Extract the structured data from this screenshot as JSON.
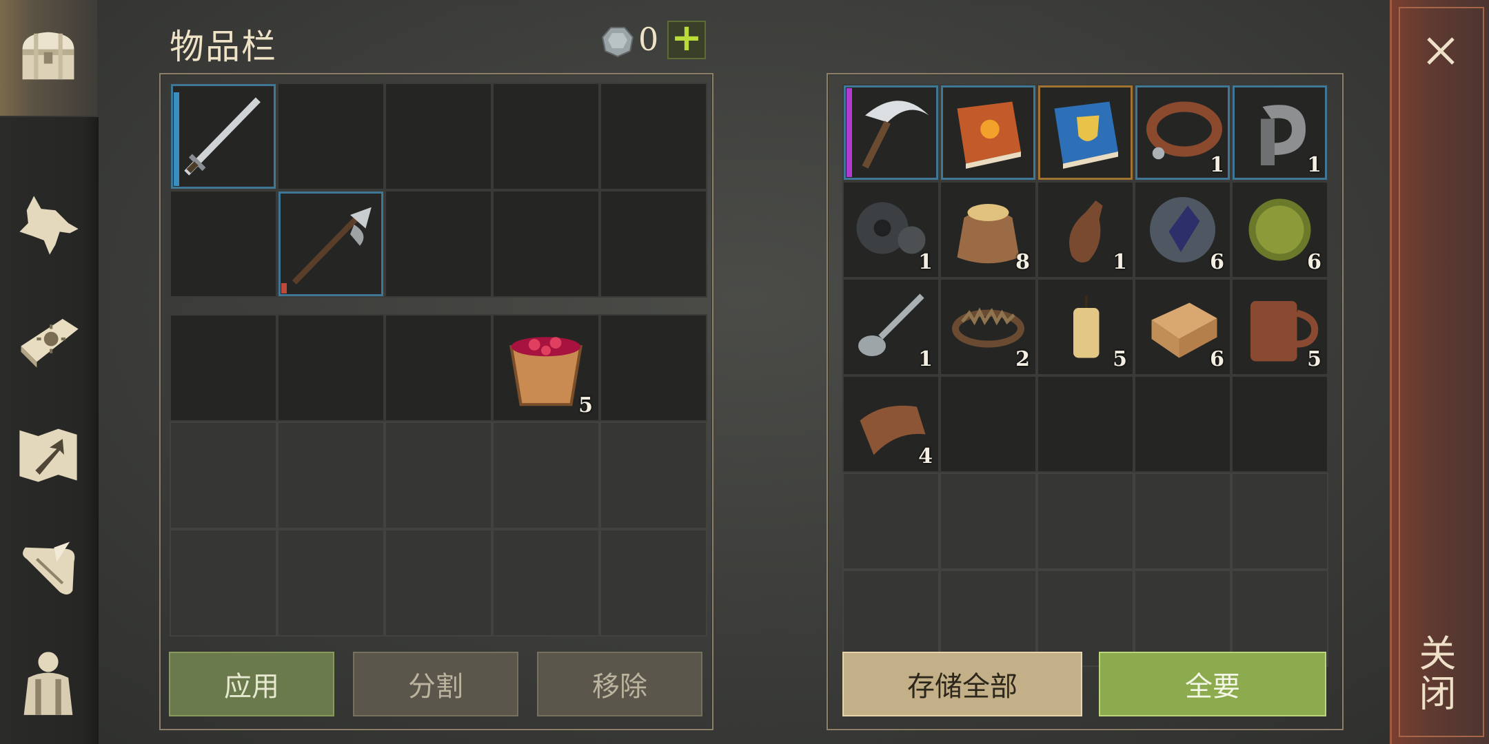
{
  "header": {
    "title": "物品栏",
    "currency_value": "0"
  },
  "player_inventory": {
    "equipment_slots": [
      {
        "item": "sword",
        "frame": "blue",
        "bar_color": "#3a8fc2",
        "bar_fraction": 0.95
      },
      {
        "item": null
      },
      {
        "item": null
      },
      {
        "item": null
      },
      {
        "item": null
      },
      {
        "item": null
      },
      {
        "item": "halberd",
        "frame": "blue",
        "bar_color": "#c04a3a",
        "bar_fraction": 0.15
      },
      {
        "item": null
      },
      {
        "item": null
      },
      {
        "item": null
      }
    ],
    "backpack_slots": [
      {
        "item": null
      },
      {
        "item": null
      },
      {
        "item": null
      },
      {
        "item": "berry-bucket",
        "count": "5"
      },
      {
        "item": null
      },
      {
        "item": null,
        "locked": true
      },
      {
        "item": null,
        "locked": true
      },
      {
        "item": null,
        "locked": true
      },
      {
        "item": null,
        "locked": true
      },
      {
        "item": null,
        "locked": true
      },
      {
        "item": null,
        "locked": true
      },
      {
        "item": null,
        "locked": true
      },
      {
        "item": null,
        "locked": true
      },
      {
        "item": null,
        "locked": true
      },
      {
        "item": null,
        "locked": true
      }
    ]
  },
  "container": {
    "slots": [
      {
        "item": "sickle",
        "frame": "purple"
      },
      {
        "item": "orange-book",
        "frame": "blue"
      },
      {
        "item": "blue-book",
        "frame": "orange"
      },
      {
        "item": "collar",
        "frame": "blue",
        "count": "1"
      },
      {
        "item": "iron-clamp",
        "frame": "blue",
        "count": "1"
      },
      {
        "item": "gear",
        "count": "1"
      },
      {
        "item": "grain-sack",
        "count": "8"
      },
      {
        "item": "leather-bottle",
        "count": "1"
      },
      {
        "item": "crystal",
        "count": "6"
      },
      {
        "item": "herb-ball",
        "count": "6"
      },
      {
        "item": "spoon",
        "count": "1"
      },
      {
        "item": "bear-trap",
        "count": "2"
      },
      {
        "item": "candle",
        "count": "5"
      },
      {
        "item": "cloth",
        "count": "6"
      },
      {
        "item": "wood-mug",
        "count": "5"
      },
      {
        "item": "leather-scrap",
        "count": "4"
      },
      {
        "item": null
      },
      {
        "item": null
      },
      {
        "item": null
      },
      {
        "item": null
      },
      {
        "item": null,
        "locked": true
      },
      {
        "item": null,
        "locked": true
      },
      {
        "item": null,
        "locked": true
      },
      {
        "item": null,
        "locked": true
      },
      {
        "item": null,
        "locked": true
      },
      {
        "item": null,
        "locked": true
      },
      {
        "item": null,
        "locked": true
      },
      {
        "item": null,
        "locked": true
      },
      {
        "item": null,
        "locked": true
      },
      {
        "item": null,
        "locked": true
      }
    ]
  },
  "actions": {
    "apply": "应用",
    "split": "分割",
    "remove": "移除",
    "store_all": "存储全部",
    "take_all": "全要"
  },
  "close": {
    "label": "关闭"
  },
  "nav": {
    "items": [
      "chest-icon",
      "wolf-icon",
      "sun-book-icon",
      "map-arrow-icon",
      "scroll-icon",
      "character-icon"
    ],
    "active": "chest-icon"
  },
  "colors": {
    "accent_green": "#8cab4e",
    "frame_blue": "#3f7896",
    "frame_purple": "#b43bd0",
    "frame_orange": "#a27432"
  }
}
